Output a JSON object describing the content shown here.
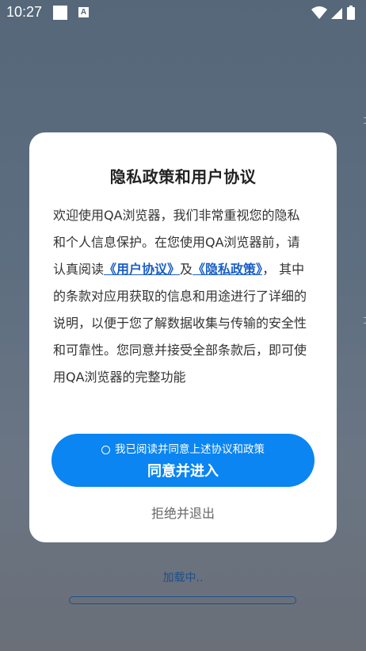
{
  "status_bar": {
    "time": "10:27",
    "a_badge": "A",
    "icons": [
      "square-icon",
      "a-notification-icon",
      "wifi-icon",
      "signal-icon",
      "battery-icon"
    ]
  },
  "dialog": {
    "title": "隐私政策和用户协议",
    "body_intro": "欢迎使用QA浏览器，我们非常重视您的隐私和个人信息保护。在您使用QA浏览器前，请认真阅读",
    "user_agreement_link": "《用户协议》",
    "and_word": "及",
    "privacy_policy_link": "《隐私政策》",
    "body_rest": "， 其中的条款对应用获取的信息和用途进行了详细的说明，以便于您了解数据收集与传输的安全性和可靠性。您同意并接受全部条款后，即可使用QA浏览器的完整功能",
    "consent_checkbox_label": "我已阅读并同意上述协议和政策",
    "consent_checked": false,
    "agree_button_label": "同意并进入",
    "reject_button_label": "拒绝并退出"
  },
  "loading": {
    "text": "加载中..",
    "progress": 0
  },
  "colors": {
    "accent": "#0a85f2",
    "link": "#1a5fc8",
    "loading": "#1e4f86"
  }
}
